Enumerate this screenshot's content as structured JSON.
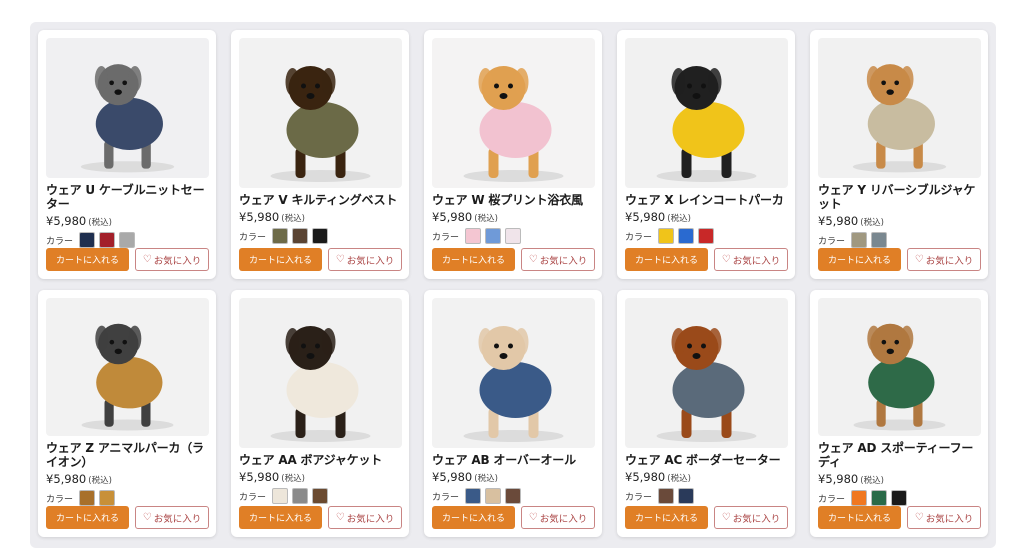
{
  "common": {
    "color_label": "カラー",
    "cart_label": "カートに入れる",
    "fav_label": "お気に入り",
    "tax_label": "(税込)"
  },
  "products": [
    {
      "name": "ウェア U ケーブルニットセーター",
      "price": "¥5,980",
      "colors": [
        "#1f2f4f",
        "#a3202a",
        "#a9a9a9"
      ],
      "bg": "#f0f0f2",
      "dog": "#6b6b6b",
      "wear": "#3a4a6a"
    },
    {
      "name": "ウェア V キルティングベスト",
      "price": "¥5,980",
      "colors": [
        "#6d6a48",
        "#5a4433",
        "#1a1a1a"
      ],
      "bg": "#f2f2f2",
      "dog": "#3a2410",
      "wear": "#6b6a47"
    },
    {
      "name": "ウェア W 桜プリント浴衣風",
      "price": "¥5,980",
      "colors": [
        "#f4c6d2",
        "#6f9ad8",
        "#f0e4ea"
      ],
      "bg": "#f4f3f3",
      "dog": "#e0a050",
      "wear": "#f2c2d0"
    },
    {
      "name": "ウェア X レインコートパーカ",
      "price": "¥5,980",
      "colors": [
        "#f0c41a",
        "#2a6ad0",
        "#c82828"
      ],
      "bg": "#f1f1f1",
      "dog": "#202020",
      "wear": "#f0c41a"
    },
    {
      "name": "ウェア Y リバーシブルジャケット",
      "price": "¥5,980",
      "colors": [
        "#a09880",
        "#7a8890"
      ],
      "bg": "#f1f1f1",
      "dog": "#c88a48",
      "wear": "#c8bca0"
    },
    {
      "name": "ウェア Z アニマルパーカ（ライオン）",
      "price": "¥5,980",
      "colors": [
        "#a8702a",
        "#c89038"
      ],
      "bg": "#f2f2f2",
      "dog": "#404040",
      "wear": "#c08a3a"
    },
    {
      "name": "ウェア AA ボアジャケット",
      "price": "¥5,980",
      "colors": [
        "#ede6da",
        "#8a8a8a",
        "#6a4a30"
      ],
      "bg": "#f1f1f1",
      "dog": "#2a2018",
      "wear": "#efe8dc"
    },
    {
      "name": "ウェア AB オーバーオール",
      "price": "¥5,980",
      "colors": [
        "#3a5a88",
        "#d8c0a0",
        "#6a4a3a"
      ],
      "bg": "#f2f2f2",
      "dog": "#e2c8a8",
      "wear": "#3a5a88"
    },
    {
      "name": "ウェア AC ボーダーセーター",
      "price": "¥5,980",
      "colors": [
        "#6a4a3a",
        "#2a3a5a"
      ],
      "bg": "#f1f1f1",
      "dog": "#9a4a1a",
      "wear": "#5a6a7a"
    },
    {
      "name": "ウェア AD スポーティーフーディ",
      "price": "¥5,980",
      "colors": [
        "#f07820",
        "#2a6a48",
        "#1a1a1a"
      ],
      "bg": "#f1f1f1",
      "dog": "#b07840",
      "wear": "#2e6a48"
    }
  ]
}
